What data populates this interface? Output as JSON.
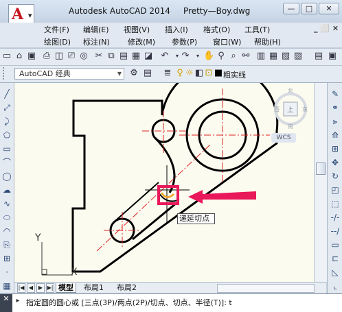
{
  "titlebar": {
    "app_name": "Autodesk AutoCAD 2014",
    "file_name": "Pretty—Boy.dwg",
    "min_glyph": "—",
    "max_glyph": "□",
    "close_glyph": "✕"
  },
  "menus": {
    "row1": [
      "文件(F)",
      "编辑(E)",
      "视图(V)",
      "插入(I)",
      "格式(O)",
      "工具(T)"
    ],
    "row2": [
      "绘图(D)",
      "标注(N)",
      "修改(M)",
      "参数(P)",
      "窗口(W)",
      "帮助(H)"
    ],
    "row1_controls": "_ ⬜ ✕"
  },
  "toolbar": {
    "workspace": "AutoCAD 经典",
    "layer_name": "粗实线"
  },
  "viewcube": {
    "top": "北",
    "left": "西",
    "right": "东",
    "bottom": "南",
    "face": "上",
    "wcs": "WCS"
  },
  "tooltip": "递延切点",
  "ucs": {
    "x": "X",
    "y": "Y"
  },
  "tabs": [
    "模型",
    "布局1",
    "布局2"
  ],
  "command": {
    "text": "指定圆的圆心或 [三点(3P)/两点(2P)/切点、切点、半径(T)]: t",
    "close_glyph": "✕"
  },
  "colors": {
    "canvas": "#fcfbef",
    "highlight": "#e8185a",
    "centerline": "#e02020",
    "snap_marker": "#f0a020"
  }
}
